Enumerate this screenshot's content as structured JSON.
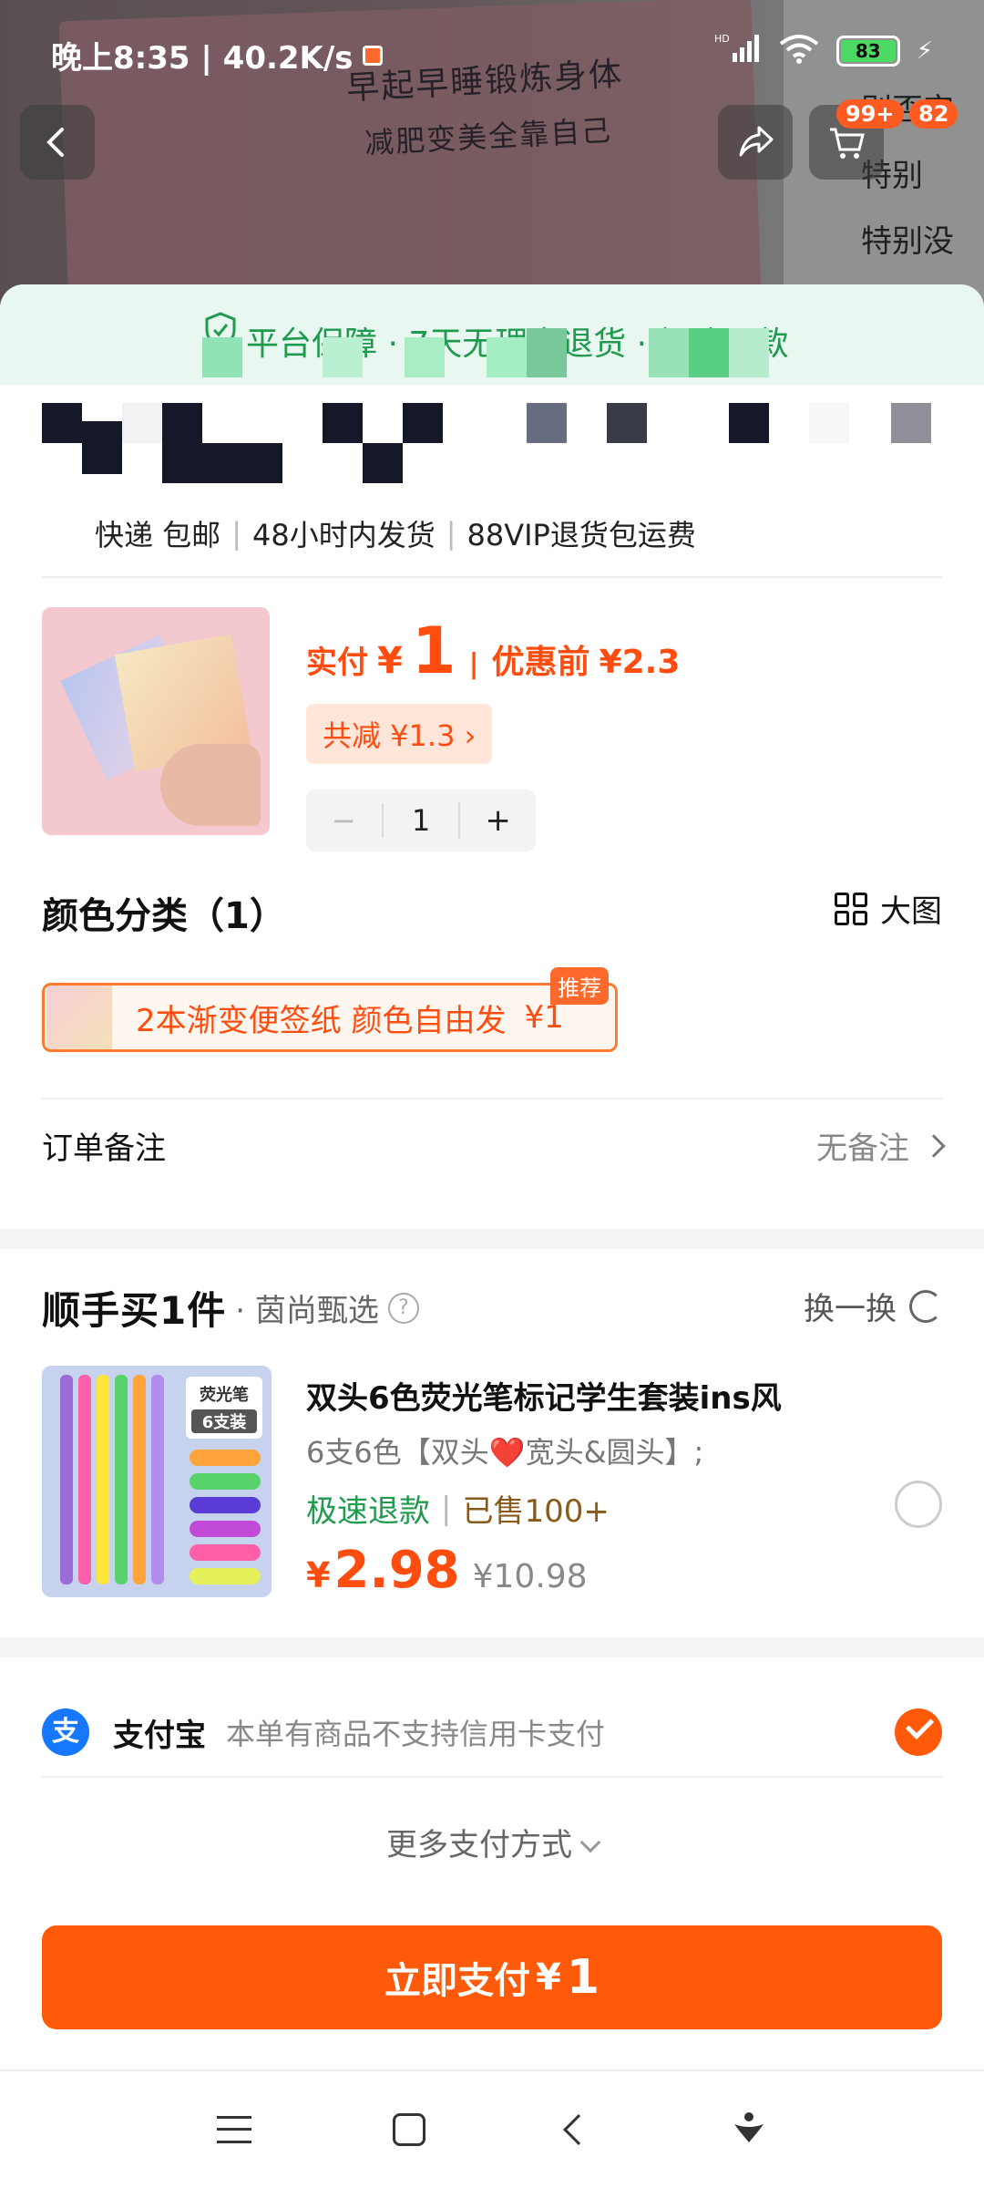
{
  "status_bar": {
    "time_speed": "晚上8:35 | 40.2K/s",
    "signal": "HD",
    "battery": "83"
  },
  "photo": {
    "line1": "早起早睡锻炼身体",
    "line2": "减肥变美全靠自己",
    "side": "别否定\n特别\n特别没\n特别值"
  },
  "header": {
    "cart_badge": "99+",
    "msg_badge": "82"
  },
  "guarantee": {
    "text": "平台保障 · 7天无理由退货 · 极速退款"
  },
  "shipping": {
    "partial_text": "普通快递寄送",
    "items": [
      "快递 包邮",
      "48小时内发货",
      "88VIP退货包运费"
    ]
  },
  "product": {
    "pay_label": "实付",
    "currency": "¥",
    "price": "1",
    "before_label": "优惠前",
    "before_price": "¥2.3",
    "discount": "共减 ¥1.3 ›",
    "quantity": "1",
    "minus": "−",
    "plus": "+"
  },
  "color_section": {
    "title": "颜色分类（1）",
    "big_pic": "大图",
    "variant_name": "2本渐变便签纸 颜色自由发",
    "variant_price": "¥1",
    "recommend_tag": "推荐"
  },
  "order_note": {
    "label": "订单备注",
    "value": "无备注"
  },
  "buy_one": {
    "logo": "顺手买1件",
    "shop": "· 茵尚甄选",
    "swap": "换一换",
    "title": "双头6色荧光笔标记学生套装ins风",
    "spec": "6支6色【双头❤️宽头&圆头】;",
    "fast_refund": "极速退款",
    "sold": "已售100+",
    "currency": "¥",
    "price": "2.98",
    "orig_price": "¥10.98",
    "thumb_label1": "荧光笔",
    "thumb_label2": "6支装"
  },
  "payment": {
    "alipay_icon": "支",
    "method": "支付宝",
    "note": "本单有商品不支持信用卡支付",
    "more": "更多支付方式",
    "pay_button": "立即支付",
    "pay_currency": "¥",
    "pay_amount": "1"
  },
  "colors": {
    "accent": "#ff5a0a",
    "green": "#1f9a4f",
    "alipay": "#1677ff"
  }
}
